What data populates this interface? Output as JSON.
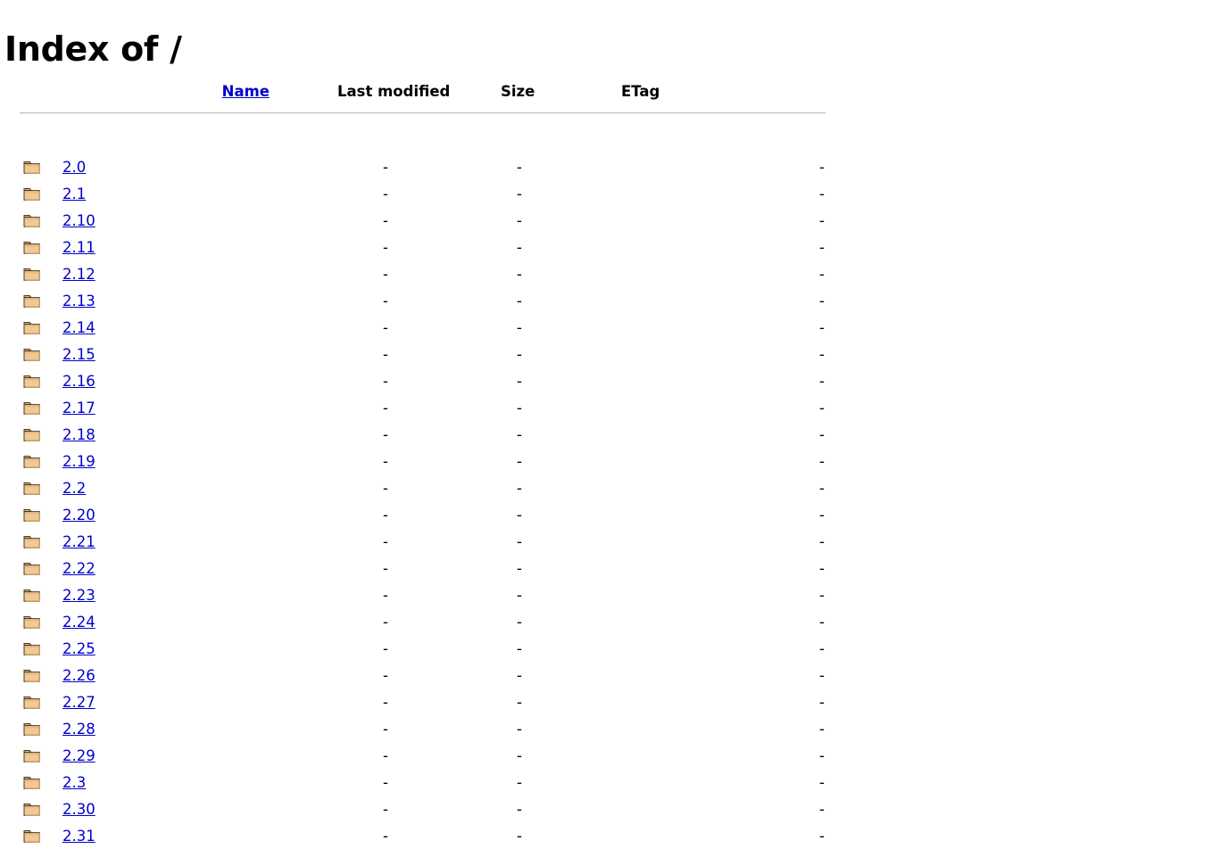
{
  "page": {
    "title": "Index of /"
  },
  "colors": {
    "link": "#0000cc",
    "text": "#000000",
    "background": "#ffffff",
    "rule": "#bdbdbd",
    "folder_fill": "#f0c995",
    "folder_shade": "#d9a865",
    "folder_outline": "#4b3b22"
  },
  "table": {
    "headers": {
      "icon": "",
      "name": "Name",
      "last_modified": "Last modified",
      "size": "Size",
      "etag": "ETag"
    },
    "icon_name": "folder-icon",
    "empty_value": "-",
    "rows": [
      {
        "name": "2.0",
        "last_modified": "-",
        "size": "-",
        "etag": "-"
      },
      {
        "name": "2.1",
        "last_modified": "-",
        "size": "-",
        "etag": "-"
      },
      {
        "name": "2.10",
        "last_modified": "-",
        "size": "-",
        "etag": "-"
      },
      {
        "name": "2.11",
        "last_modified": "-",
        "size": "-",
        "etag": "-"
      },
      {
        "name": "2.12",
        "last_modified": "-",
        "size": "-",
        "etag": "-"
      },
      {
        "name": "2.13",
        "last_modified": "-",
        "size": "-",
        "etag": "-"
      },
      {
        "name": "2.14",
        "last_modified": "-",
        "size": "-",
        "etag": "-"
      },
      {
        "name": "2.15",
        "last_modified": "-",
        "size": "-",
        "etag": "-"
      },
      {
        "name": "2.16",
        "last_modified": "-",
        "size": "-",
        "etag": "-"
      },
      {
        "name": "2.17",
        "last_modified": "-",
        "size": "-",
        "etag": "-"
      },
      {
        "name": "2.18",
        "last_modified": "-",
        "size": "-",
        "etag": "-"
      },
      {
        "name": "2.19",
        "last_modified": "-",
        "size": "-",
        "etag": "-"
      },
      {
        "name": "2.2",
        "last_modified": "-",
        "size": "-",
        "etag": "-"
      },
      {
        "name": "2.20",
        "last_modified": "-",
        "size": "-",
        "etag": "-"
      },
      {
        "name": "2.21",
        "last_modified": "-",
        "size": "-",
        "etag": "-"
      },
      {
        "name": "2.22",
        "last_modified": "-",
        "size": "-",
        "etag": "-"
      },
      {
        "name": "2.23",
        "last_modified": "-",
        "size": "-",
        "etag": "-"
      },
      {
        "name": "2.24",
        "last_modified": "-",
        "size": "-",
        "etag": "-"
      },
      {
        "name": "2.25",
        "last_modified": "-",
        "size": "-",
        "etag": "-"
      },
      {
        "name": "2.26",
        "last_modified": "-",
        "size": "-",
        "etag": "-"
      },
      {
        "name": "2.27",
        "last_modified": "-",
        "size": "-",
        "etag": "-"
      },
      {
        "name": "2.28",
        "last_modified": "-",
        "size": "-",
        "etag": "-"
      },
      {
        "name": "2.29",
        "last_modified": "-",
        "size": "-",
        "etag": "-"
      },
      {
        "name": "2.3",
        "last_modified": "-",
        "size": "-",
        "etag": "-"
      },
      {
        "name": "2.30",
        "last_modified": "-",
        "size": "-",
        "etag": "-"
      },
      {
        "name": "2.31",
        "last_modified": "-",
        "size": "-",
        "etag": "-"
      }
    ]
  }
}
